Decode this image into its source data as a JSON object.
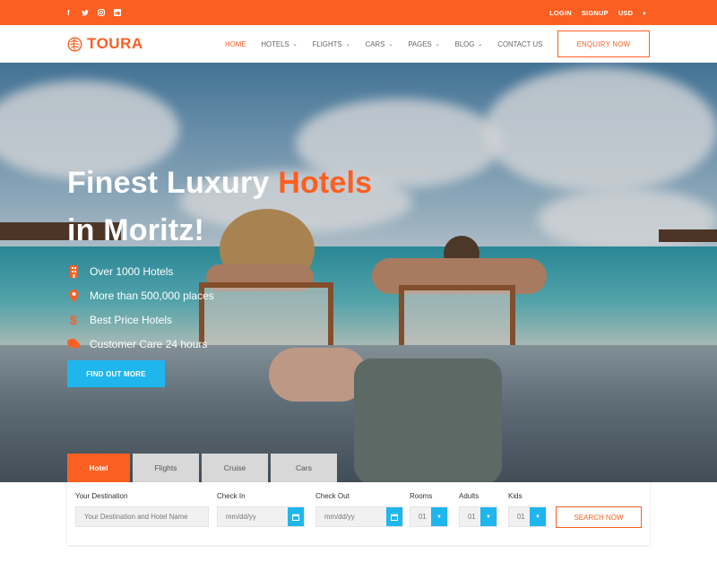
{
  "topbar": {
    "social_icons": [
      "facebook-icon",
      "twitter-icon",
      "instagram-icon",
      "linkedin-icon"
    ],
    "login": "LOGIN",
    "signup": "SIGNUP",
    "currency": "USD"
  },
  "brand": {
    "name": "TOURA",
    "accent_color": "#fb5f22"
  },
  "nav": {
    "items": [
      {
        "label": "HOME",
        "dropdown": false,
        "active": true
      },
      {
        "label": "HOTELS",
        "dropdown": true
      },
      {
        "label": "FLIGHTS",
        "dropdown": true
      },
      {
        "label": "CARS",
        "dropdown": true
      },
      {
        "label": "PAGES",
        "dropdown": true
      },
      {
        "label": "BLOG",
        "dropdown": true
      },
      {
        "label": "CONTACT US",
        "dropdown": false
      }
    ],
    "cta": "ENQUIRY NOW"
  },
  "hero": {
    "headline_part1": "Finest Luxury ",
    "headline_accent": "Hotels",
    "headline_line2": "in Moritz!",
    "features": [
      {
        "icon": "building-icon",
        "text": "Over 1000 Hotels"
      },
      {
        "icon": "map-pin-icon",
        "text": "More than 500,000 places"
      },
      {
        "icon": "dollar-icon",
        "text": "Best Price Hotels"
      },
      {
        "icon": "chat-icon",
        "text": "Customer Care 24 hours"
      }
    ],
    "button": "FIND OUT MORE",
    "button_color": "#1fb6ee"
  },
  "search": {
    "tabs": [
      "Hotel",
      "Flights",
      "Cruise",
      "Cars"
    ],
    "active_tab": "Hotel",
    "destination_label": "Your Destination",
    "destination_placeholder": "Your Destination and Hotel Name",
    "checkin_label": "Check In",
    "checkin_placeholder": "mm/dd/yy",
    "checkout_label": "Check Out",
    "checkout_placeholder": "mm/dd/yy",
    "rooms_label": "Rooms",
    "rooms_value": "01",
    "adults_label": "Adults",
    "adults_value": "01",
    "kids_label": "Kids",
    "kids_value": "01",
    "submit": "SEARCH NOW"
  }
}
